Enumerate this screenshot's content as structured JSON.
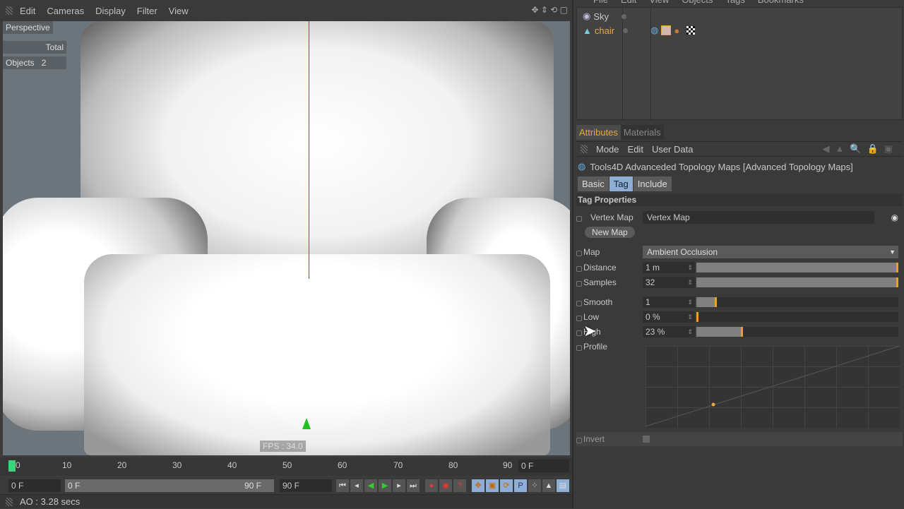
{
  "viewport": {
    "menu": [
      "Edit",
      "Cameras",
      "Display",
      "Filter",
      "View"
    ],
    "camera_label": "Perspective",
    "stats_header": "Total",
    "stats_label": "Objects",
    "stats_value": "2",
    "fps": "FPS : 34.0"
  },
  "object_manager": {
    "menu": [
      "File",
      "Edit",
      "View",
      "Objects",
      "Tags",
      "Bookmarks"
    ],
    "objects": [
      {
        "name": "Sky"
      },
      {
        "name": "chair"
      }
    ]
  },
  "attributes": {
    "tabs": [
      "Attributes",
      "Materials"
    ],
    "menu": [
      "Mode",
      "Edit",
      "User Data"
    ],
    "title": "Tools4D Advanceded Topology Maps [Advanced Topology Maps]",
    "subtabs": [
      "Basic",
      "Tag",
      "Include"
    ],
    "section": "Tag Properties",
    "vertex_map_label": "Vertex Map",
    "vertex_map_value": "Vertex Map",
    "new_map": "New Map",
    "map_label": "Map",
    "map_value": "Ambient Occlusion",
    "params": [
      {
        "label": "Distance",
        "value": "1 m",
        "fill": 1.0
      },
      {
        "label": "Samples",
        "value": "32",
        "fill": 1.0
      },
      {
        "label": "Smooth",
        "value": "1",
        "fill": 0.1
      },
      {
        "label": "Low",
        "value": "0 %",
        "fill": 0.0
      },
      {
        "label": "High",
        "value": "23 %",
        "fill": 0.23
      }
    ],
    "profile_label": "Profile",
    "invert_label": "Invert"
  },
  "timeline": {
    "ticks": [
      "0",
      "10",
      "20",
      "30",
      "40",
      "50",
      "60",
      "70",
      "80",
      "90"
    ],
    "current_frame": "0 F",
    "start": "0 F",
    "range_start": "0 F",
    "range_end": "90 F",
    "end": "90 F"
  },
  "status": {
    "text": "AO : 3.28 secs"
  },
  "colors": {
    "accent": "#e7a93c",
    "tab_active": "#8faed6"
  }
}
